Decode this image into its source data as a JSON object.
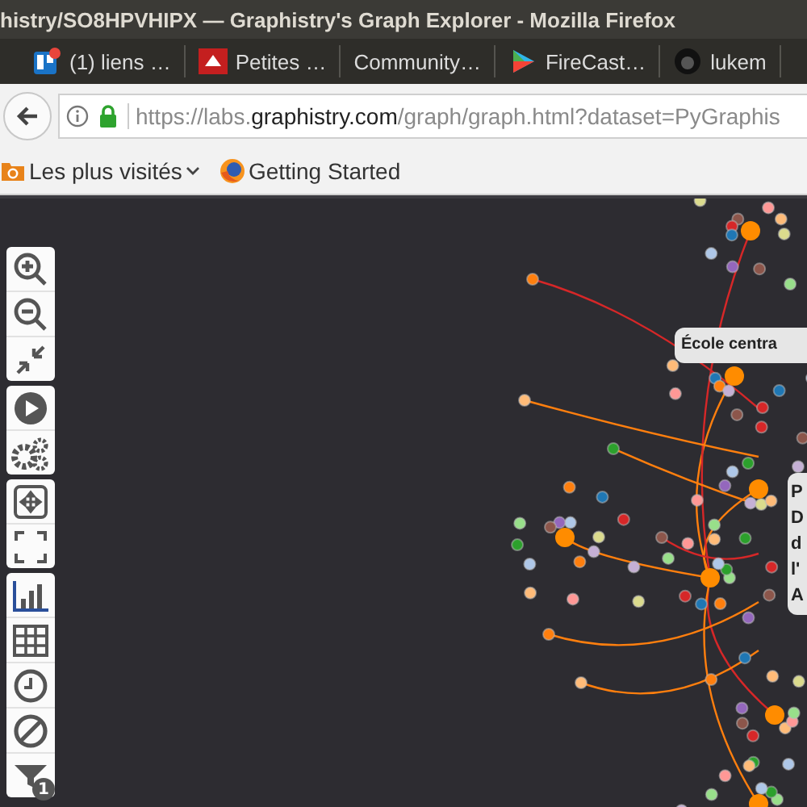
{
  "window": {
    "title": "histry/SO8HPVHIPX — Graphistry's Graph Explorer - Mozilla Firefox"
  },
  "links": [
    {
      "label": "(1) liens …"
    },
    {
      "label": "Petites …"
    },
    {
      "label": "Community…"
    },
    {
      "label": "FireCast…"
    },
    {
      "label": "lukem"
    }
  ],
  "address_bar": {
    "prefix": "https://labs.",
    "domain": "graphistry.com",
    "path": "/graph/graph.html?dataset=PyGraphis"
  },
  "bookmarks": [
    {
      "label": "Les plus visités",
      "kind": "folder"
    },
    {
      "label": "Getting Started",
      "kind": "firefox"
    }
  ],
  "filter_badge": "1",
  "graph_labels": [
    {
      "lines": [
        "École centra"
      ]
    },
    {
      "lines": [
        "P",
        "D",
        "d",
        "l'",
        "A"
      ]
    }
  ]
}
